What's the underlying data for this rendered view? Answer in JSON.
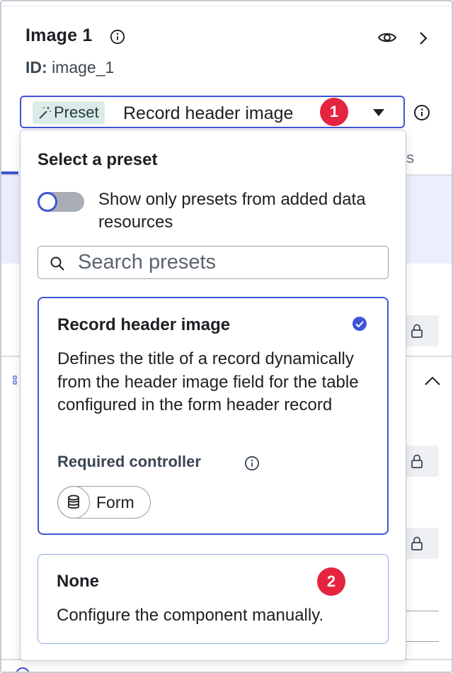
{
  "header": {
    "title": "Image 1",
    "id_label": "ID:",
    "id_value": "image_1"
  },
  "preset_select": {
    "chip_label": "Preset",
    "value": "Record header image"
  },
  "annotations": {
    "badge_1": "1",
    "badge_2": "2",
    "badge_color": "#e5243f"
  },
  "background": {
    "tab_fragment": "ts"
  },
  "popover": {
    "title": "Select a preset",
    "toggle": {
      "label": "Show only presets from added data resources",
      "on": false
    },
    "search": {
      "placeholder": "Search presets",
      "value": ""
    },
    "presets": [
      {
        "title": "Record header image",
        "description": "Defines the title of a record dynamically from the header image field for the table configured in the form header record",
        "required_label": "Required controller",
        "controller": "Form",
        "selected": true
      },
      {
        "title": "None",
        "description": "Configure the component manually.",
        "selected": false
      }
    ]
  },
  "colors": {
    "accent": "#3f55d6",
    "chip_bg": "#dbece8",
    "text": "#1e1f24"
  },
  "icons": [
    "info-icon",
    "eye-icon",
    "chevron-right-icon",
    "magic-wand-icon",
    "caret-down-icon",
    "search-icon",
    "check-circle-icon",
    "database-icon",
    "lock-icon",
    "chevron-up-icon"
  ]
}
